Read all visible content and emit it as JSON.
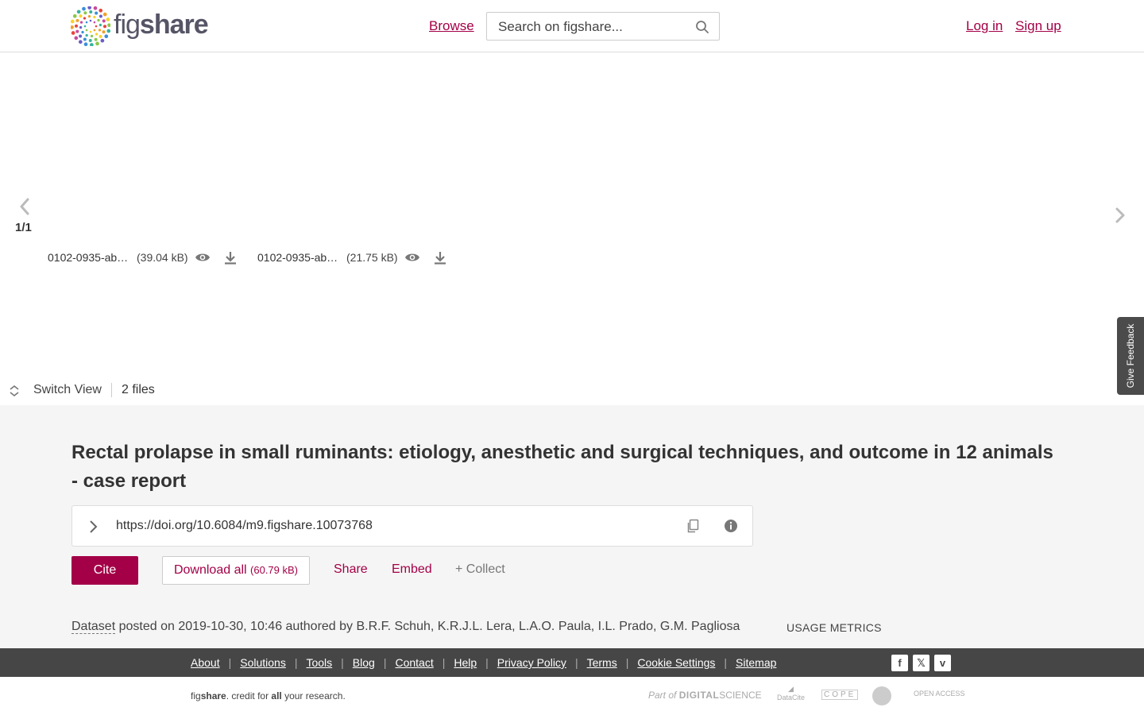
{
  "header": {
    "logo_text_light": "fig",
    "logo_text_bold": "share",
    "browse_label": "Browse",
    "search_placeholder": "Search on figshare...",
    "login_label": "Log in",
    "signup_label": "Sign up"
  },
  "viewer": {
    "pager": "1/1",
    "files": [
      {
        "name": "0102-0935-ab…",
        "size": "(39.04 kB)"
      },
      {
        "name": "0102-0935-ab…",
        "size": "(21.75 kB)"
      }
    ],
    "feedback_label": "Give Feedback",
    "switch_view_label": "Switch View",
    "files_count": "2 files"
  },
  "item": {
    "title": "Rectal prolapse in small ruminants: etiology, anesthetic and surgical techniques, and outcome in 12 animals - case report",
    "doi": "https://doi.org/10.6084/m9.figshare.10073768",
    "cite_label": "Cite",
    "download_label": "Download all",
    "download_size": "(60.79 kB)",
    "share_label": "Share",
    "embed_label": "Embed",
    "collect_label": "+ Collect",
    "type": "Dataset",
    "posted_text": " posted on 2019-10-30, 10:46 authored by B.R.F. Schuh, K.R.J.L. Lera, L.A.O. Paula, I.L. Prado, G.M. Pagliosa",
    "usage_label": "USAGE METRICS"
  },
  "footer": {
    "links": [
      "About",
      "Solutions",
      "Tools",
      "Blog",
      "Contact",
      "Help",
      "Privacy Policy",
      "Terms",
      "Cookie Settings",
      "Sitemap"
    ],
    "social": [
      "facebook-icon",
      "x-icon",
      "vimeo-icon"
    ],
    "tagline_pre": "fig",
    "tagline_bold": "share",
    "tagline_mid": ". credit for ",
    "tagline_all": "all",
    "tagline_post": " your research.",
    "partner_ds_pre": "Part of ",
    "partner_ds": "DIGITAL",
    "partner_ds_post": "SCIENCE",
    "partner_datacite": "DataCite",
    "partner_cope": "COPE",
    "partner_oa": "OPEN ACCESS"
  },
  "colors": {
    "accent": "#a30047",
    "footer_bg": "#464646",
    "info_bg": "#f5f5f5"
  }
}
